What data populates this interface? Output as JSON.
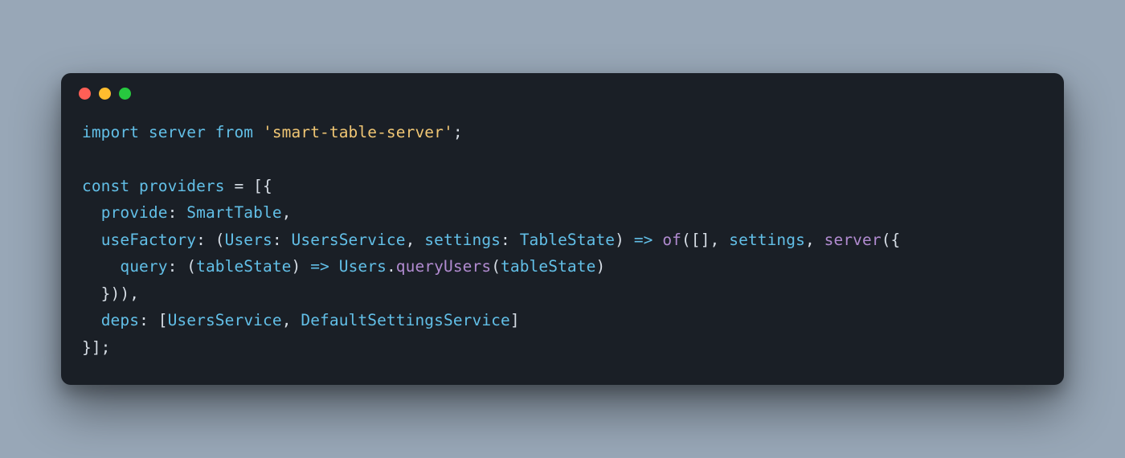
{
  "colors": {
    "background_page": "#98a7b7",
    "background_window": "#1a1f26",
    "dot_red": "#ff5f56",
    "dot_yellow": "#ffbd2e",
    "dot_green": "#27c93f",
    "token_keyword": "#62bfe7",
    "token_default": "#d6dde5",
    "token_string": "#f0c674",
    "token_function": "#b18bd0"
  },
  "code": {
    "language": "javascript",
    "raw": "import server from 'smart-table-server';\n\nconst providers = [{\n  provide: SmartTable,\n  useFactory: (Users: UsersService, settings: TableState) => of([], settings, server({\n    query: (tableState) => Users.queryUsers(tableState)\n  })),\n  deps: [UsersService, DefaultSettingsService]\n}];",
    "tokens": [
      [
        {
          "t": "import",
          "c": "kw"
        },
        {
          "t": " ",
          "c": "op"
        },
        {
          "t": "server",
          "c": "kw"
        },
        {
          "t": " ",
          "c": "op"
        },
        {
          "t": "from",
          "c": "kw"
        },
        {
          "t": " ",
          "c": "op"
        },
        {
          "t": "'smart-table-server'",
          "c": "str"
        },
        {
          "t": ";",
          "c": "op"
        }
      ],
      [],
      [
        {
          "t": "const",
          "c": "kw"
        },
        {
          "t": " ",
          "c": "op"
        },
        {
          "t": "providers",
          "c": "kw"
        },
        {
          "t": " = [{",
          "c": "op"
        }
      ],
      [
        {
          "t": "  ",
          "c": "op"
        },
        {
          "t": "provide",
          "c": "kw"
        },
        {
          "t": ":",
          "c": "op"
        },
        {
          "t": " ",
          "c": "op"
        },
        {
          "t": "SmartTable",
          "c": "kw"
        },
        {
          "t": ",",
          "c": "op"
        }
      ],
      [
        {
          "t": "  ",
          "c": "op"
        },
        {
          "t": "useFactory",
          "c": "kw"
        },
        {
          "t": ":",
          "c": "op"
        },
        {
          "t": " (",
          "c": "op"
        },
        {
          "t": "Users",
          "c": "kw"
        },
        {
          "t": ":",
          "c": "op"
        },
        {
          "t": " ",
          "c": "op"
        },
        {
          "t": "UsersService",
          "c": "kw"
        },
        {
          "t": ", ",
          "c": "op"
        },
        {
          "t": "settings",
          "c": "kw"
        },
        {
          "t": ":",
          "c": "op"
        },
        {
          "t": " ",
          "c": "op"
        },
        {
          "t": "TableState",
          "c": "kw"
        },
        {
          "t": ")",
          "c": "op"
        },
        {
          "t": " ",
          "c": "op"
        },
        {
          "t": "=>",
          "c": "kw"
        },
        {
          "t": " ",
          "c": "op"
        },
        {
          "t": "of",
          "c": "fn"
        },
        {
          "t": "([], ",
          "c": "op"
        },
        {
          "t": "settings",
          "c": "kw"
        },
        {
          "t": ", ",
          "c": "op"
        },
        {
          "t": "server",
          "c": "fn"
        },
        {
          "t": "({",
          "c": "op"
        }
      ],
      [
        {
          "t": "    ",
          "c": "op"
        },
        {
          "t": "query",
          "c": "kw"
        },
        {
          "t": ":",
          "c": "op"
        },
        {
          "t": " (",
          "c": "op"
        },
        {
          "t": "tableState",
          "c": "kw"
        },
        {
          "t": ")",
          "c": "op"
        },
        {
          "t": " ",
          "c": "op"
        },
        {
          "t": "=>",
          "c": "kw"
        },
        {
          "t": " ",
          "c": "op"
        },
        {
          "t": "Users",
          "c": "kw"
        },
        {
          "t": ".",
          "c": "op"
        },
        {
          "t": "queryUsers",
          "c": "fn"
        },
        {
          "t": "(",
          "c": "op"
        },
        {
          "t": "tableState",
          "c": "kw"
        },
        {
          "t": ")",
          "c": "op"
        }
      ],
      [
        {
          "t": "  })),",
          "c": "op"
        }
      ],
      [
        {
          "t": "  ",
          "c": "op"
        },
        {
          "t": "deps",
          "c": "kw"
        },
        {
          "t": ":",
          "c": "op"
        },
        {
          "t": " [",
          "c": "op"
        },
        {
          "t": "UsersService",
          "c": "kw"
        },
        {
          "t": ", ",
          "c": "op"
        },
        {
          "t": "DefaultSettingsService",
          "c": "kw"
        },
        {
          "t": "]",
          "c": "op"
        }
      ],
      [
        {
          "t": "}];",
          "c": "op"
        }
      ]
    ]
  }
}
